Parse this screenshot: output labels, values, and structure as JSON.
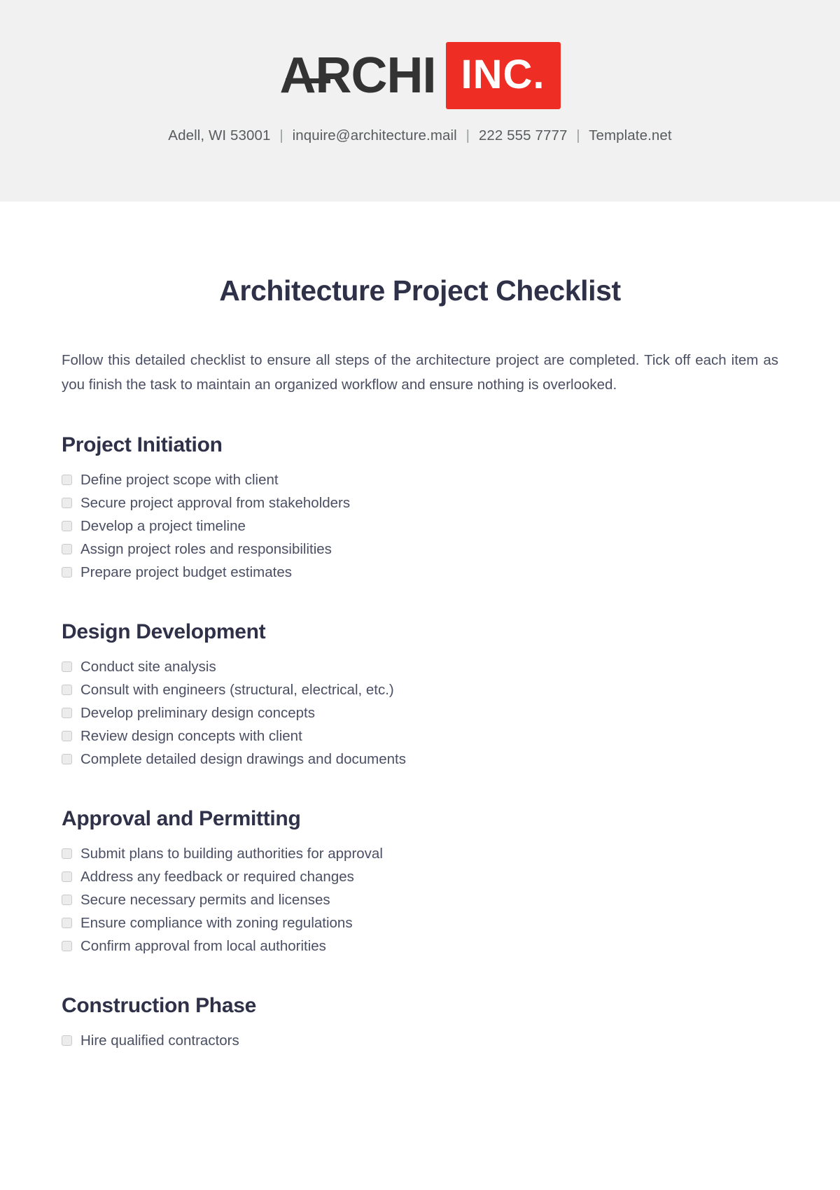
{
  "header": {
    "logo": {
      "word": "ARCHI",
      "badge": "INC.",
      "badge_color": "#ee2d24",
      "word_color": "#333333"
    },
    "contact": {
      "address": "Adell, WI 53001",
      "email": "inquire@architecture.mail",
      "phone": "222 555 7777",
      "website": "Template.net",
      "separator": "|"
    },
    "band_color": "#f0f1f0"
  },
  "document": {
    "title": "Architecture Project Checklist",
    "title_color": "#2e3148",
    "intro": "Follow this detailed checklist to ensure all steps of the architecture project are completed. Tick off each item as you finish the task to maintain an organized workflow and ensure nothing is overlooked.",
    "sections": [
      {
        "title": "Project Initiation",
        "items": [
          "Define project scope with client",
          "Secure project approval from stakeholders",
          "Develop a project timeline",
          "Assign project roles and responsibilities",
          "Prepare project budget estimates"
        ]
      },
      {
        "title": "Design Development",
        "items": [
          "Conduct site analysis",
          "Consult with engineers (structural, electrical, etc.)",
          "Develop preliminary design concepts",
          "Review design concepts with client",
          "Complete detailed design drawings and documents"
        ]
      },
      {
        "title": "Approval and Permitting",
        "items": [
          "Submit plans to building authorities for approval",
          "Address any feedback or required changes",
          "Secure necessary permits and licenses",
          "Ensure compliance with zoning regulations",
          "Confirm approval from local authorities"
        ]
      },
      {
        "title": "Construction Phase",
        "items": [
          "Hire qualified contractors"
        ]
      }
    ]
  }
}
